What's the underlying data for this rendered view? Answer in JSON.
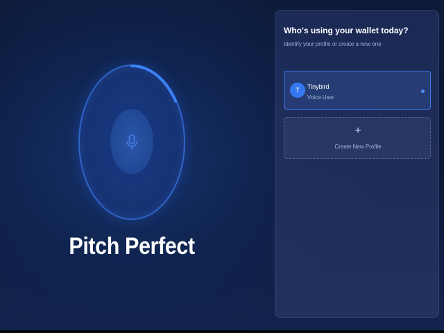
{
  "brand": {
    "title": "Pitch Perfect",
    "recording_progress": 0.16,
    "accent_color": "#3b82f6"
  },
  "icons": {
    "mic": "microphone-icon",
    "plus": "plus-icon"
  },
  "panel": {
    "title": "Who's using your wallet today?",
    "subtitle": "Identify your profile or create a new one",
    "profiles": [
      {
        "initial": "T",
        "name": "Tinybird",
        "role": "Voice User",
        "selected": true
      }
    ],
    "create_profile": {
      "icon_glyph": "+",
      "label": "Create New Profile"
    }
  }
}
